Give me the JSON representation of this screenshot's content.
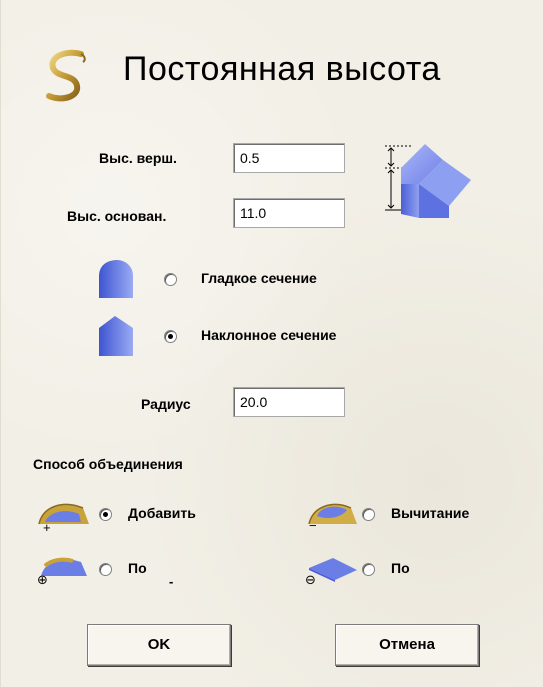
{
  "dialog": {
    "title": "Постоянная высота",
    "top_height_label": "Выс. верш.",
    "top_height_value": "0.5",
    "base_height_label": "Выс. основан.",
    "base_height_value": "11.0",
    "profile_options": [
      {
        "label": "Гладкое сечение",
        "checked": false
      },
      {
        "label": "Наклонное сечение",
        "checked": true
      }
    ],
    "radius_label": "Радиус",
    "radius_value": "20.0",
    "combine_title": "Способ объединения",
    "combine_options": {
      "add_label": "Добавить",
      "subtract_label": "Вычитание",
      "add_by_label": "По",
      "sub_by_label": "По",
      "add_checked": true
    },
    "glyphs": {
      "plus": "+",
      "minus": "−",
      "circle_plus": "⊕",
      "circle_minus": "⊖",
      "dash": "-"
    },
    "buttons": {
      "ok": "OK",
      "cancel": "Отмена"
    }
  },
  "colors": {
    "background": "#f2efe6",
    "shape_blue": "#6b7ee6",
    "gold": "#c8a23a"
  }
}
